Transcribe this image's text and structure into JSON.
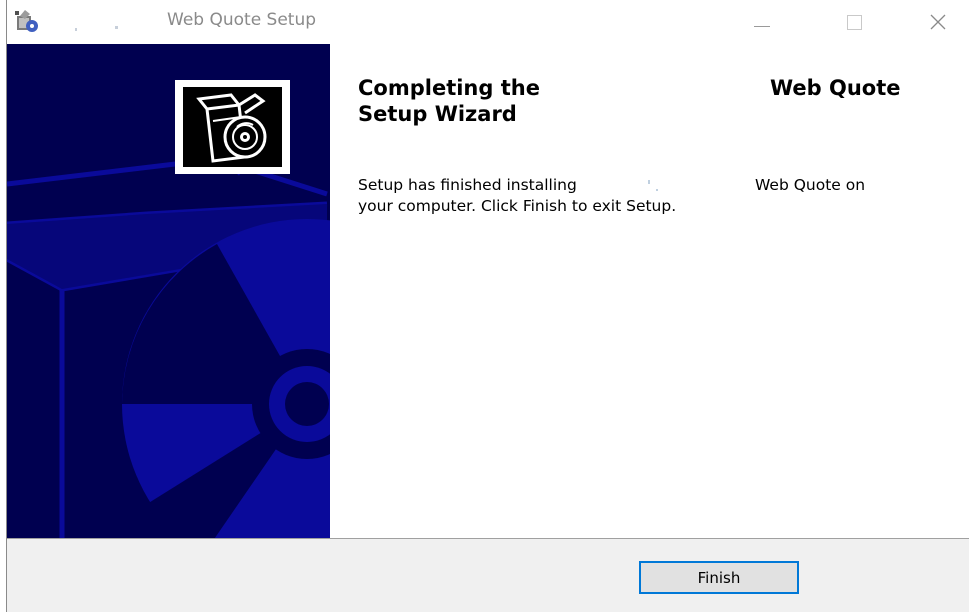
{
  "window": {
    "title": "Web Quote Setup",
    "controls": {
      "minimize": "minimize",
      "maximize": "maximize",
      "close": "close"
    }
  },
  "content": {
    "heading_part1": "Completing the",
    "heading_part2": "Web Quote",
    "heading_line2": "Setup Wizard",
    "body_part1": "Setup has finished installing",
    "body_part2": "Web Quote on",
    "body_line2": "your computer. Click Finish to exit Setup."
  },
  "footer": {
    "finish_label": "Finish"
  },
  "icons": [
    "installer-app-icon",
    "software-box-cd-icon",
    "minimize-icon",
    "maximize-icon",
    "close-icon"
  ],
  "colors": {
    "banner_bg": "#000050",
    "banner_art": "#0a0a9a",
    "button_focus": "#0078d7",
    "footer_bg": "#f0f0f0"
  }
}
